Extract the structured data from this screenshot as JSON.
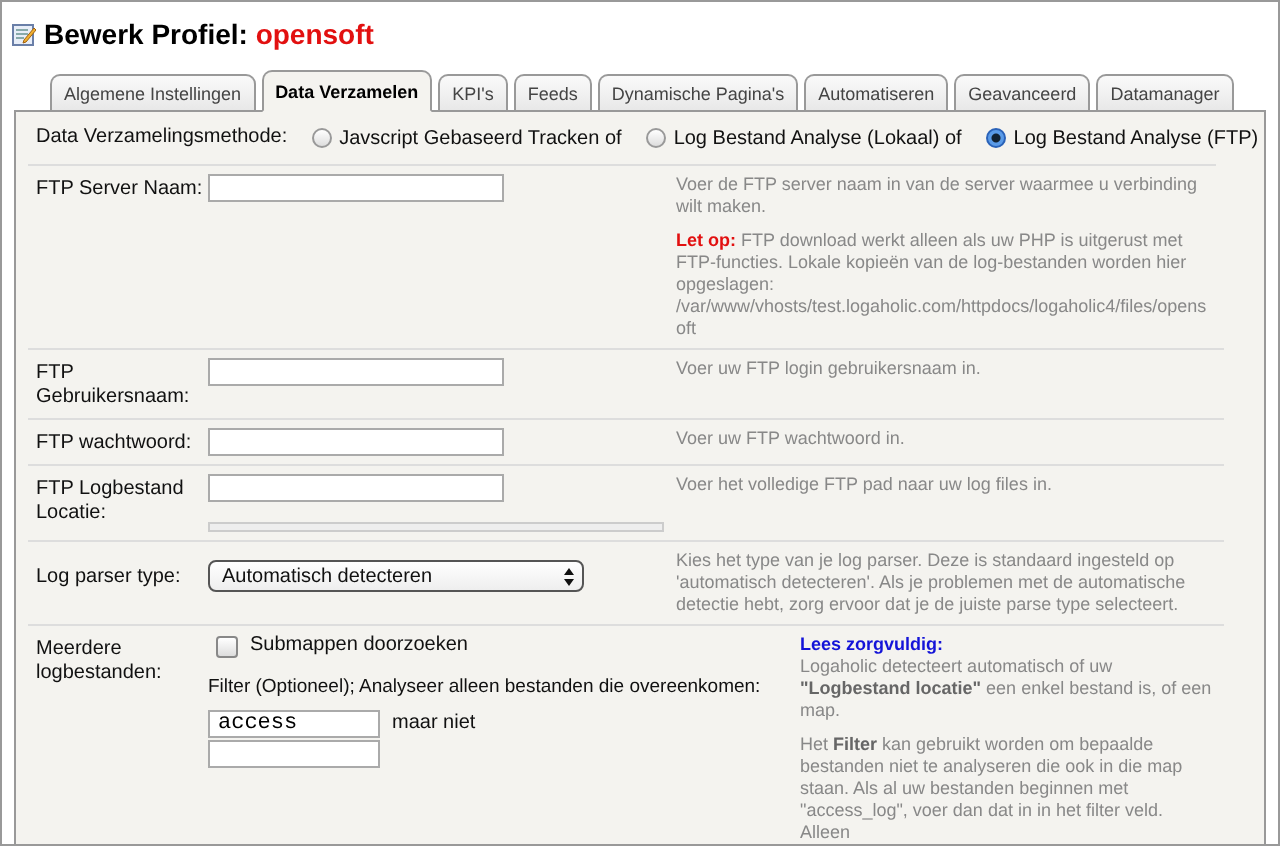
{
  "title": {
    "prefix": "Bewerk Profiel:",
    "name": "opensoft"
  },
  "tabs": [
    {
      "label": "Algemene Instellingen",
      "selected": false
    },
    {
      "label": "Data Verzamelen",
      "selected": true
    },
    {
      "label": "KPI's",
      "selected": false
    },
    {
      "label": "Feeds",
      "selected": false
    },
    {
      "label": "Dynamische Pagina's",
      "selected": false
    },
    {
      "label": "Automatiseren",
      "selected": false
    },
    {
      "label": "Geavanceerd",
      "selected": false
    },
    {
      "label": "Datamanager",
      "selected": false
    }
  ],
  "method": {
    "label": "Data Verzamelingsmethode:",
    "options": [
      {
        "label": "Javscript Gebaseerd Tracken of",
        "selected": false
      },
      {
        "label": "Log Bestand Analyse (Lokaal) of",
        "selected": false
      },
      {
        "label": "Log Bestand Analyse (FTP)",
        "selected": true
      }
    ]
  },
  "fields": [
    {
      "kind": "text",
      "label": "FTP Server Naam:",
      "help": [
        {
          "text": "Voer de FTP server naam in van de server waarmee u verbinding wilt maken."
        },
        {
          "lead": "Let op:",
          "kind": "warning",
          "text": "FTP download werkt alleen als uw PHP is uitgerust met FTP-functies. Lokale kopieën van de log-bestanden worden hier opgeslagen: /var/www/vhosts/test.logaholic.com/httpdocs/logaholic4/files/opensoft"
        }
      ]
    },
    {
      "kind": "text",
      "label": "FTP Gebruikersnaam:",
      "help": [
        {
          "text": "Voer uw FTP login gebruikersnaam in."
        }
      ]
    },
    {
      "kind": "text",
      "label": "FTP wachtwoord:",
      "help": [
        {
          "text": "Voer uw FTP wachtwoord in."
        }
      ]
    },
    {
      "kind": "text_bar",
      "label": "FTP Logbestand Locatie:",
      "help": [
        {
          "text": "Voer het volledige FTP pad naar uw log files in."
        }
      ]
    },
    {
      "kind": "select",
      "label": "Log parser type:",
      "value": "Automatisch detecteren",
      "help": [
        {
          "text": "Kies het type van je log parser. Deze is standaard ingesteld op 'automatisch detecteren'. Als je problemen met de automatische detectie hebt, zorg ervoor dat je de juiste parse type selecteert."
        }
      ]
    },
    {
      "kind": "multi",
      "label": "Meerdere logbestanden:",
      "checkbox": {
        "label": "Submappen doorzoeken",
        "checked": false
      },
      "filter_label": "Filter (Optioneel); Analyseer alleen bestanden die overeenkomen:",
      "include": "access",
      "between": "maar niet",
      "help": [
        {
          "lead": "Lees zorgvuldig:",
          "kind": "heading",
          "text": "Logaholic detecteert automatisch of uw **\"Logbestand locatie\"** een enkel bestand is, of een map."
        },
        {
          "text": "Het **Filter** kan gebruikt worden om bepaalde bestanden niet te analyseren die ook in die map staan. Als al uw bestanden beginnen met \"access_log\", voer dan dat in in het filter veld. Alleen"
        }
      ]
    }
  ]
}
